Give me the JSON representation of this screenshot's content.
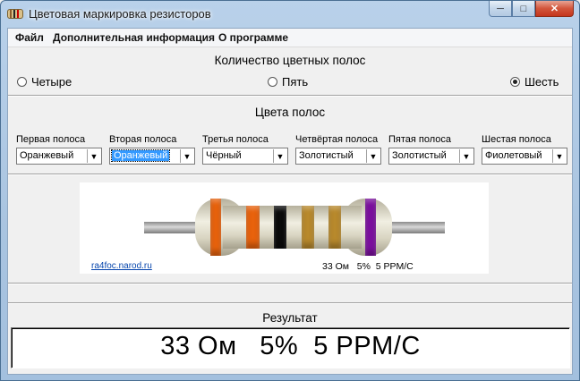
{
  "window": {
    "title": "Цветовая маркировка резисторов",
    "buttons": {
      "minimize_icon": "minimize-icon",
      "maximize_icon": "maximize-icon",
      "close_icon": "close-icon"
    }
  },
  "menu": {
    "items": [
      "Файл",
      "Дополнительная информация",
      "О программе"
    ]
  },
  "band_count": {
    "title": "Количество цветных полос",
    "options": [
      {
        "label": "Четыре",
        "checked": false
      },
      {
        "label": "Пять",
        "checked": false
      },
      {
        "label": "Шесть",
        "checked": true
      }
    ]
  },
  "bands": {
    "title": "Цвета полос",
    "selectors": [
      {
        "label": "Первая полоса",
        "value": "Оранжевый"
      },
      {
        "label": "Вторая полоса",
        "value": "Оранжевый"
      },
      {
        "label": "Третья полоса",
        "value": "Чёрный"
      },
      {
        "label": "Четвёртая полоса",
        "value": "Золотистый"
      },
      {
        "label": "Пятая полоса",
        "value": "Золотистый"
      },
      {
        "label": "Шестая полоса",
        "value": "Фиолетовый"
      }
    ]
  },
  "picture": {
    "link": "ra4foc.narod.ru",
    "caption": "33 Ом   5%  5 PPM/C",
    "band_colors": [
      "#e8620c",
      "#e8620c",
      "#0a0a0a",
      "#b8892c",
      "#b8892c",
      "#7b0f9e"
    ]
  },
  "result": {
    "title": "Результат",
    "value": "33 Ом   5%  5 PPM/C"
  }
}
